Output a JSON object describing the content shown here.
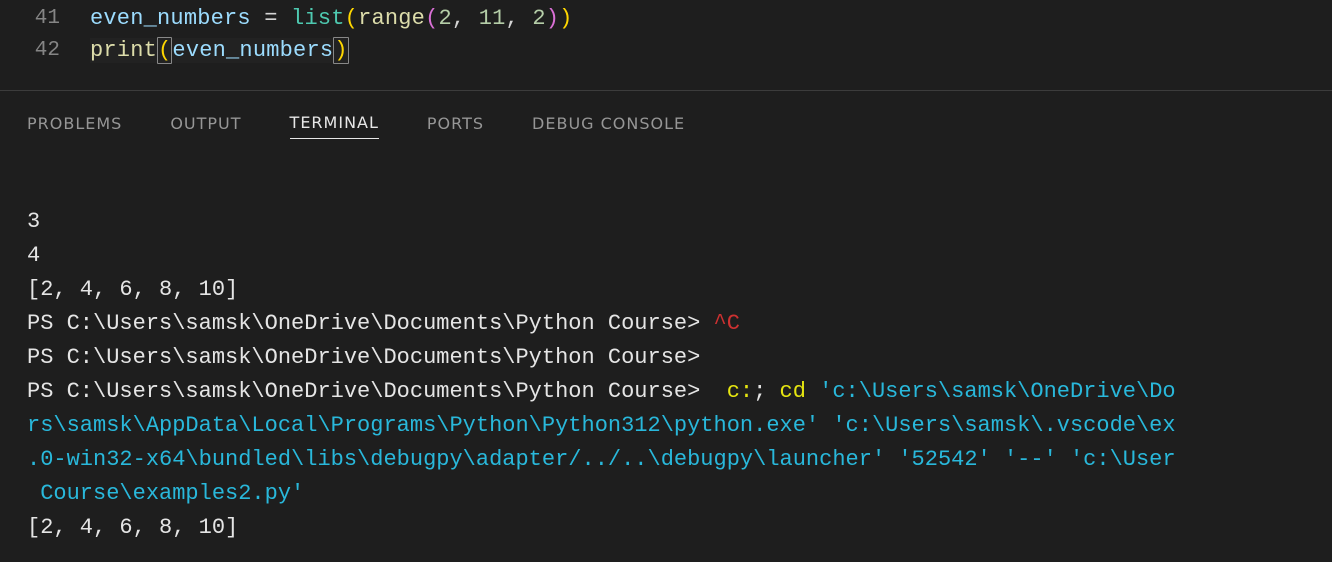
{
  "editor": {
    "lines": [
      {
        "num": "41"
      },
      {
        "num": "42"
      }
    ],
    "line41": {
      "var": "even_numbers",
      "eq": " = ",
      "list": "list",
      "op1": "(",
      "range": "range",
      "op2": "(",
      "n1": "2",
      "c1": ", ",
      "n2": "11",
      "c2": ", ",
      "n3": "2",
      "cp2": ")",
      "cp1": ")"
    },
    "line42": {
      "print": "print",
      "op": "(",
      "arg": "even_numbers",
      "cp": ")"
    }
  },
  "tabs": {
    "problems": "PROBLEMS",
    "output": "OUTPUT",
    "terminal": "TERMINAL",
    "ports": "PORTS",
    "debug": "DEBUG CONSOLE"
  },
  "terminal": {
    "l1": "3",
    "l2": "4",
    "l3": "[2, 4, 6, 8, 10]",
    "l4a": "PS C:\\Users\\samsk\\OneDrive\\Documents\\Python Course> ",
    "l4b": "^C",
    "l5": "PS C:\\Users\\samsk\\OneDrive\\Documents\\Python Course> ",
    "l6a": "PS C:\\Users\\samsk\\OneDrive\\Documents\\Python Course>  ",
    "l6b": "c:",
    "l6c": "; ",
    "l6d": "cd",
    "l6e": " ",
    "l6f": "'c:\\Users\\samsk\\OneDrive\\Do",
    "l7": "rs\\samsk\\AppData\\Local\\Programs\\Python\\Python312\\python.exe' 'c:\\Users\\samsk\\.vscode\\ex",
    "l8": ".0-win32-x64\\bundled\\libs\\debugpy\\adapter/../..\\debugpy\\launcher' '52542' '--' 'c:\\User",
    "l9": " Course\\examples2.py'",
    "l10": "[2, 4, 6, 8, 10]"
  }
}
